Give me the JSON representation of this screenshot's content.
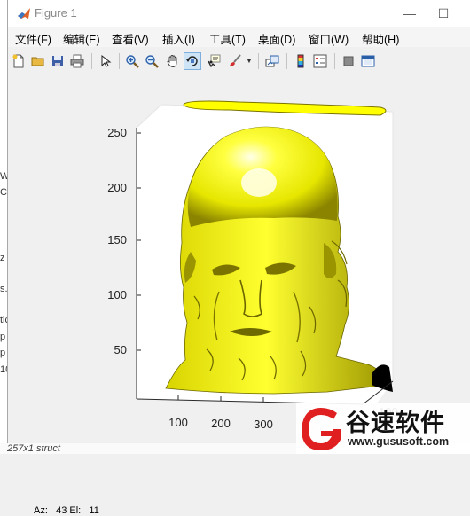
{
  "window": {
    "title": "Figure 1",
    "controls": [
      "—",
      "☐"
    ]
  },
  "menu": [
    "文件(F)",
    "编辑(E)",
    "查看(V)",
    "插入(I)",
    "工具(T)",
    "桌面(D)",
    "窗口(W)",
    "帮助(H)"
  ],
  "toolbar": [
    "new-figure",
    "open-file",
    "save",
    "print",
    "edit-plot",
    "zoom-in",
    "zoom-out",
    "pan",
    "rotate-3d",
    "data-cursor",
    "brush",
    "link-plot",
    "insert-colorbar",
    "insert-legend",
    "hide-plot-tools",
    "show-plot-tools"
  ],
  "axes": {
    "y_ticks": [
      "250",
      "200",
      "150",
      "100",
      "50"
    ],
    "x_ticks": [
      "100",
      "200",
      "300"
    ],
    "z_ticks": [
      "100"
    ]
  },
  "status": {
    "az_label": "Az:",
    "az": "43",
    "el_label": "El:",
    "el": "11"
  },
  "background": {
    "left_fragments": [
      "W",
      "C",
      "z",
      "s.",
      "tic",
      "p",
      "p",
      "10"
    ],
    "bottom_text": "257x1 struct"
  },
  "watermark": {
    "brand": "谷速软件",
    "url": "www.gususoft.com"
  },
  "colors": {
    "surface": "#ffff00",
    "surface_shadow": "#6b6600",
    "axes_bg": "#ffffff"
  }
}
